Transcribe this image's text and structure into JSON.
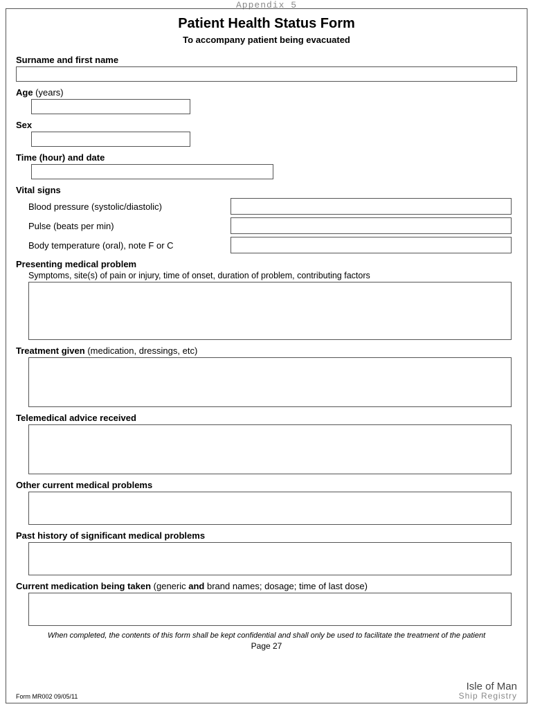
{
  "appendix": "Appendix 5",
  "title": "Patient Health Status Form",
  "subtitle": "To accompany patient being evacuated",
  "fields": {
    "surname": {
      "label_bold": "Surname and first name"
    },
    "age": {
      "label_bold": "Age",
      "label_rest": " (years)"
    },
    "sex": {
      "label_bold": "Sex"
    },
    "time": {
      "label_bold": "Time (hour) and date"
    },
    "vitals_header": "Vital signs",
    "bp": "Blood pressure (systolic/diastolic)",
    "pulse": "Pulse (beats per min)",
    "temp": "Body temperature (oral), note F or C",
    "presenting": {
      "label_bold": "Presenting medical problem",
      "desc": "Symptoms, site(s) of pain or injury, time of onset, duration of problem, contributing factors"
    },
    "treatment": {
      "label_bold": "Treatment given",
      "label_rest": " (medication, dressings, etc)"
    },
    "telemedical": {
      "label_bold": "Telemedical advice received"
    },
    "other": {
      "label_bold": "Other current medical problems"
    },
    "past": {
      "label_bold": "Past history of significant medical problems"
    },
    "current_med": {
      "label_bold": "Current medication being taken",
      "label_rest_a": " (generic ",
      "label_rest_bold": "and",
      "label_rest_b": " brand names; dosage; time of last dose)"
    }
  },
  "footer": {
    "note": "When completed, the contents of this form shall be kept confidential and shall only be used to facilitate the treatment of the patient",
    "page": "Page  27",
    "form_code": "Form MR002  09/05/11",
    "logo_top": "Isle of Man",
    "logo_bot": "Ship Registry"
  }
}
